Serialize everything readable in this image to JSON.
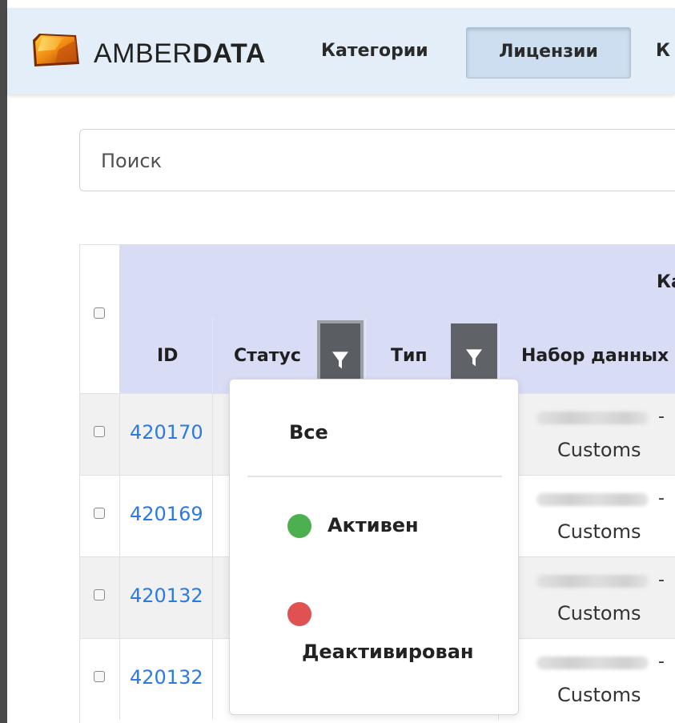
{
  "app": {
    "brand_light": "AMBER",
    "brand_bold": "DATA"
  },
  "nav": {
    "items": [
      {
        "label": "Категории",
        "active": false
      },
      {
        "label": "Лицензии",
        "active": true
      },
      {
        "label": "К",
        "active": false
      }
    ]
  },
  "search": {
    "placeholder": "Поиск"
  },
  "table": {
    "group_header": "Ка",
    "columns": [
      "ID",
      "Статус",
      "Тип",
      "Набор данных"
    ],
    "rows": [
      {
        "id": "420170",
        "dataset_tail": "Customs"
      },
      {
        "id": "420169",
        "dataset_tail": "Customs"
      },
      {
        "id": "420132",
        "dataset_tail": "Customs"
      },
      {
        "id": "420132",
        "dataset_tail": "Customs"
      }
    ],
    "dash": "-"
  },
  "status_filter": {
    "options": [
      {
        "label": "Все",
        "color": null
      },
      {
        "label": "Активен",
        "color": "#4caf50"
      },
      {
        "label": "Деактивирован",
        "color": "#e05252"
      }
    ]
  },
  "colors": {
    "navbar_bg": "#e4eef8",
    "header_bg": "#d8dcf5",
    "link": "#2a7ae2",
    "filter_button": "#5f6368"
  }
}
